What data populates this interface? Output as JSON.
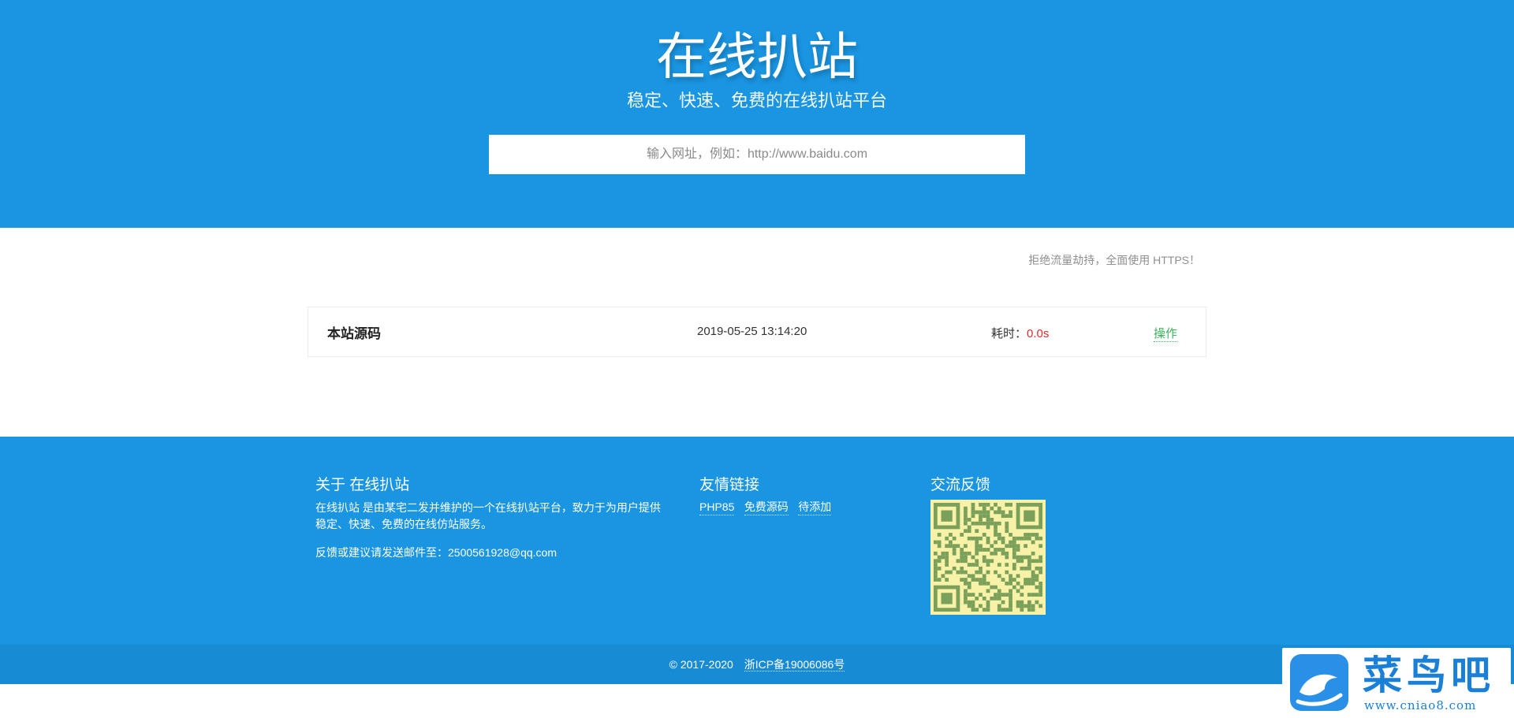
{
  "hero": {
    "title": "在线扒站",
    "subtitle": "稳定、快速、免费的在线扒站平台",
    "search_placeholder": "输入网址，例如：http://www.baidu.com"
  },
  "notice": "拒绝流量劫持，全面使用 HTTPS！",
  "result": {
    "name": "本站源码",
    "time": "2019-05-25 13:14:20",
    "cost_label": "耗时：",
    "cost_value": "0.0s",
    "action_label": "操作"
  },
  "footer": {
    "about": {
      "title": "关于 在线扒站",
      "text": "在线扒站 是由某宅二发并维护的一个在线扒站平台，致力于为用户提供稳定、快速、免费的在线仿站服务。",
      "mail": "反馈或建议请发送邮件至：2500561928@qq.com"
    },
    "links": {
      "title": "友情链接",
      "items": [
        "PHP85",
        "免费源码",
        "待添加"
      ]
    },
    "feedback": {
      "title": "交流反馈",
      "qr_icon": "qr-code-icon"
    }
  },
  "copyright": {
    "text": "© 2017-2020",
    "icp": "浙ICP备19006086号"
  },
  "watermark": {
    "name": "菜鸟吧",
    "url": "www.cniao8.com",
    "logo_icon": "bird-logo-icon"
  },
  "colors": {
    "primary": "#1a95e2",
    "copyright_bar": "#188bd5",
    "cost_red": "#e02b2b",
    "action_green": "#3cb35a",
    "qr_background": "#f7f2a8",
    "qr_modules": "#7aa05a"
  }
}
